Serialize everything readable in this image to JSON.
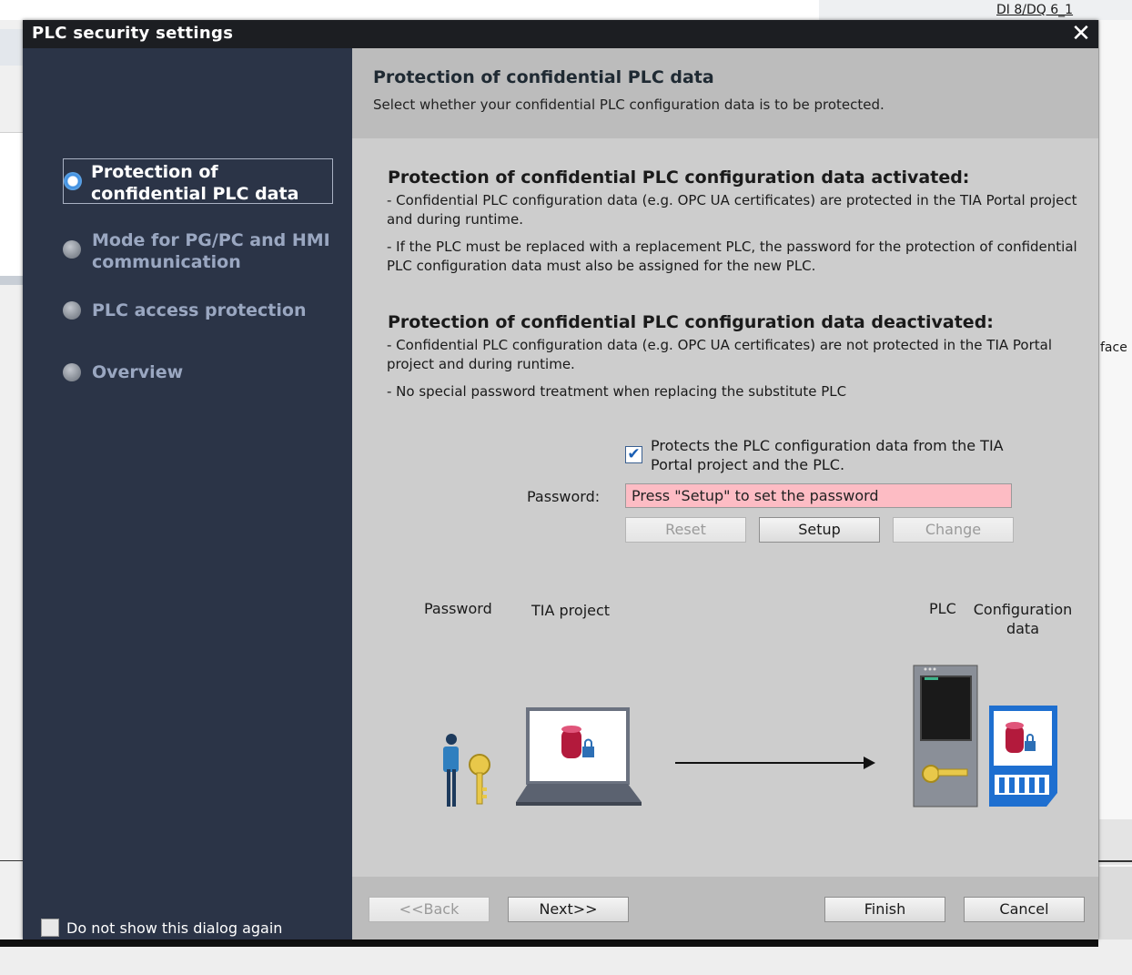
{
  "background": {
    "module_label": "DI 8/DQ 6_1",
    "edge_text": "face"
  },
  "dialog": {
    "title": "PLC security settings",
    "close_symbol": "✕"
  },
  "nav": {
    "items": [
      {
        "label": "Protection of confidential PLC data",
        "active": true
      },
      {
        "label": "Mode for PG/PC and HMI communication",
        "active": false
      },
      {
        "label": "PLC access protection",
        "active": false
      },
      {
        "label": "Overview",
        "active": false
      }
    ],
    "dont_show_label": "Do not show this dialog again"
  },
  "content": {
    "title": "Protection of confidential PLC data",
    "subtitle": "Select whether your confidential PLC configuration data is to be protected.",
    "activated_heading": "Protection of confidential PLC configuration data activated:",
    "activated_p1": "- Confidential PLC configuration data (e.g. OPC UA certificates) are protected in the TIA Portal project and during runtime.",
    "activated_p2": "- If the PLC must be replaced with a replacement PLC, the password for the protection of confidential PLC configuration data must also be assigned for the new PLC.",
    "deactivated_heading": "Protection of confidential PLC configuration data deactivated:",
    "deactivated_p1": "- Confidential PLC configuration data (e.g. OPC UA certificates) are not protected in the TIA Portal project and during runtime.",
    "deactivated_p2": "- No special password treatment when replacing the substitute PLC",
    "protect_checkbox_label": "Protects the PLC configuration data from the TIA Portal project and the PLC.",
    "protect_checked": true,
    "password_label": "Password:",
    "password_placeholder": "Press \"Setup\" to set the password",
    "reset_label": "Reset",
    "setup_label": "Setup",
    "change_label": "Change",
    "illustration": {
      "password_label": "Password",
      "tia_label": "TIA project",
      "plc_label": "PLC",
      "config_label": "Configuration data"
    }
  },
  "footer": {
    "back_label": "<<Back",
    "next_label": "Next>>",
    "finish_label": "Finish",
    "cancel_label": "Cancel"
  },
  "colors": {
    "nav_bg": "#2b3447",
    "content_bg": "#cdcdcd",
    "header_bg": "#bcbcbc",
    "password_field_bg": "#fdbcc4",
    "title_bar": "#1c1e22",
    "checkbox_check": "#1a5fb4"
  }
}
